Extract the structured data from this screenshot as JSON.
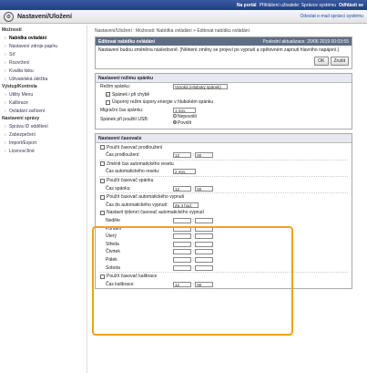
{
  "topbar": {
    "portal": "Na portál",
    "login_info": "Přihlášení uživatele: Správce systému",
    "logout": "Odhlásit se"
  },
  "header": {
    "title": "Nastavení/Uložení",
    "link": "Odeslat e-mail správci systému"
  },
  "sidebar": {
    "group1": "Možnosti",
    "items1": [
      "Nabídka ovládání",
      "Nastavení zdroje papíru",
      "Síť",
      "Rozvržení",
      "Kvalita tisku",
      "Uživatelská údržba"
    ],
    "group2": "Výstup/Kontrola",
    "items2": [
      "Utility Menu",
      "Kalibrace",
      "Ovládání zařízení"
    ],
    "group3": "Nastavení správy",
    "items3": [
      "Správa ID oddělení",
      "Zabezpečení",
      "Import/Export",
      "Licence/Jiné"
    ]
  },
  "breadcrumb": "Nastavení/Uložení : Možnosti: Nabídka ovládání > Editovat nabídku ovládání",
  "edit_panel": {
    "title": "Editovat nabídku ovládání",
    "updated": "Poslední aktualizace: 20/06 2019 00:03:55",
    "message": "Nastavení budou změněna následovně. (Některé změny se projeví po vypnutí a opětovném zapnutí hlavního napájení.)",
    "ok": "OK",
    "cancel": "Zrušit"
  },
  "sleep_panel": {
    "title": "Nastavení režimu spánku",
    "mode_label": "Režim spánku:",
    "mode_value": "Vysoká (Hluboký spánek)",
    "sleep_on_error": "Spánek i při chybě",
    "energy_saving": "Úsporný režim úspory energie v hlubokém spánku",
    "transition_label": "Migrační čas spánku:",
    "transition_value": "1 min.",
    "usb_label": "Spánek při použití USB:",
    "usb_off": "Nepovolit",
    "usb_on": "Povolit"
  },
  "timer_panel": {
    "title": "Nastavení časovače",
    "use_extension": "Použít časovač prodloužení",
    "extension_time": "Čas prodloužení:",
    "extension_h": "12",
    "extension_m": "00",
    "change_reset": "Změnit čas automatického resetu",
    "reset_time_label": "Čas automatického resetu:",
    "reset_time_value": "2 min.",
    "use_sleep_timer": "Použít časovač spánku",
    "sleep_time": "Čas spánku:",
    "sleep_h": "12",
    "sleep_m": "00",
    "use_auto_off": "Použít časovač automatického vypnutí",
    "auto_off_time_label": "Čas do automatického vypnutí:",
    "auto_off_time_value": "Za 4 hod.",
    "weekly_label": "Nastavit týdenní časovač automatického vypnutí",
    "days": [
      "Neděle",
      "Pondělí",
      "Úterý",
      "Středa",
      "Čtvrtek",
      "Pátek",
      "Sobota"
    ],
    "use_calibration": "Použít časovač kalibrace",
    "calibration_time": "Čas kalibrace:",
    "calibration_h": "12",
    "calibration_m": "00"
  }
}
